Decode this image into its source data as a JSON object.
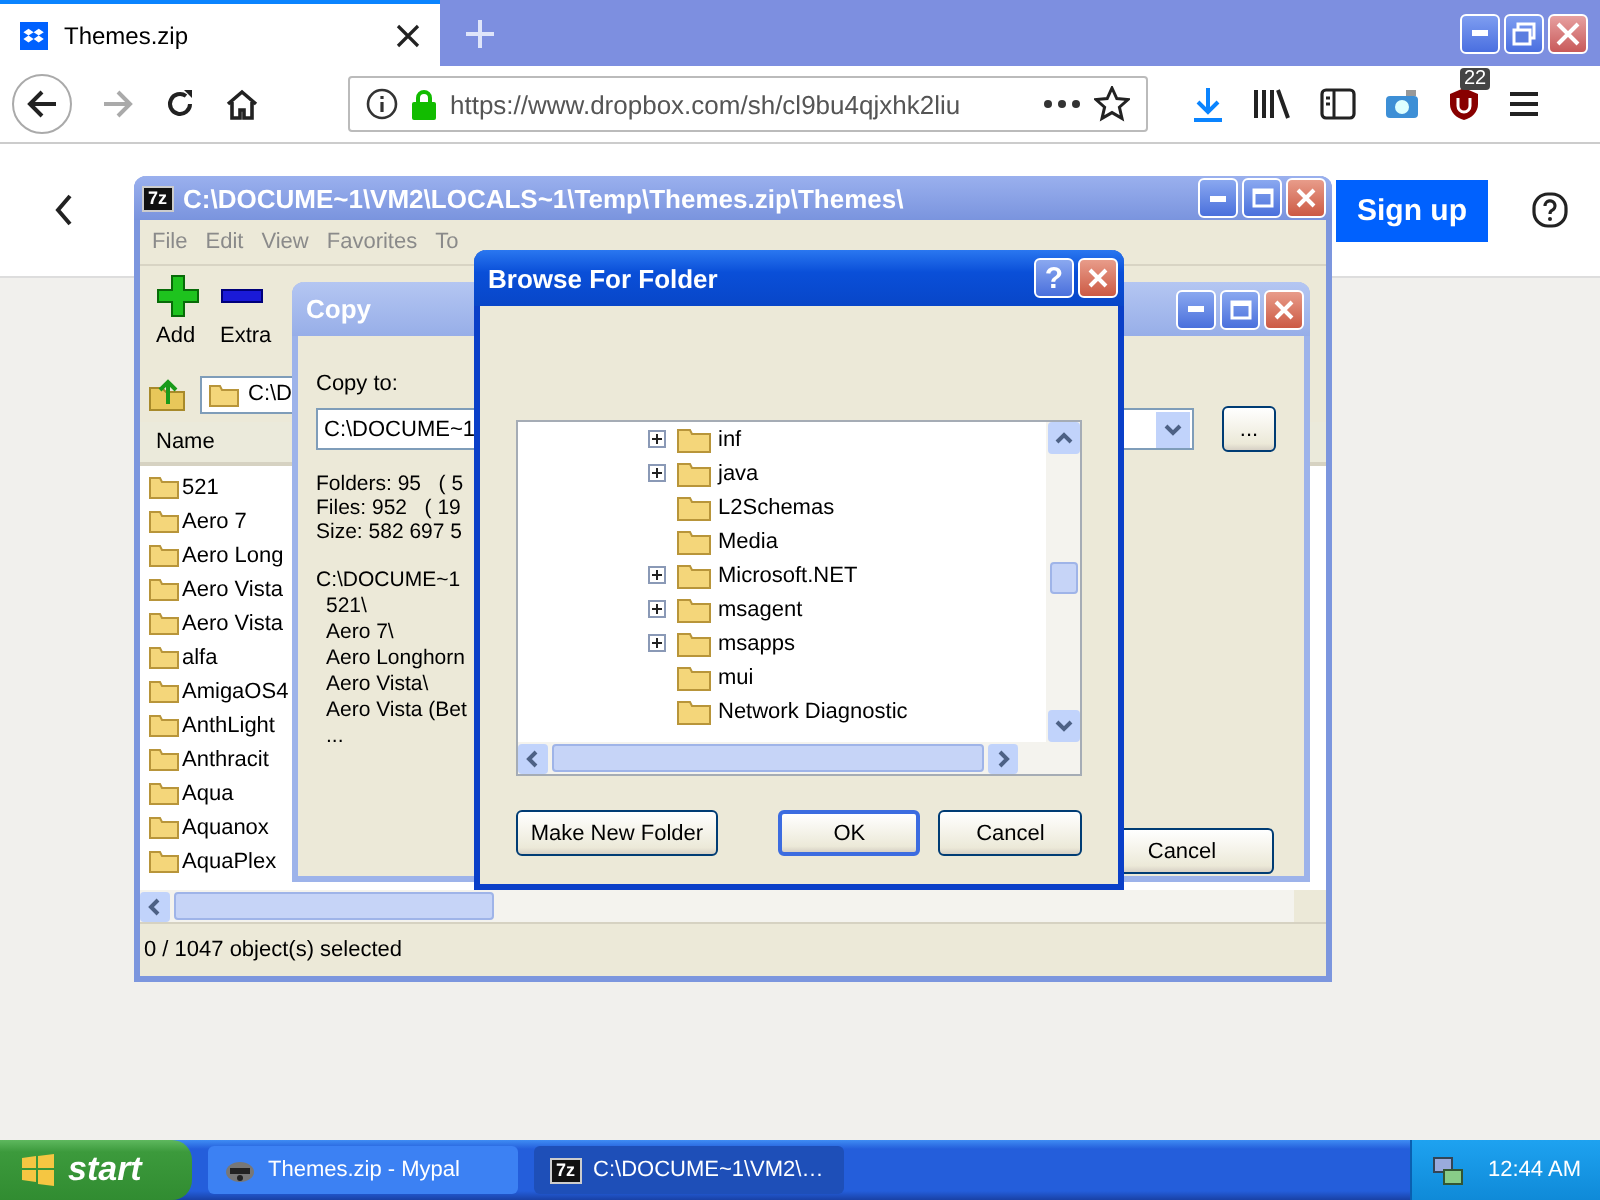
{
  "browser": {
    "tab_title": "Themes.zip",
    "forward_disabled": true,
    "url": "https://www.dropbox.com/sh/cl9bu4qjxhk2liu",
    "badge": "22"
  },
  "page": {
    "signup": "Sign up"
  },
  "zip_window": {
    "icon_label": "7z",
    "title": "C:\\DOCUME~1\\VM2\\LOCALS~1\\Temp\\Themes.zip\\Themes\\",
    "menu": [
      "File",
      "Edit",
      "View",
      "Favorites",
      "To"
    ],
    "toolbar": [
      {
        "label": "Add",
        "kind": "add"
      },
      {
        "label": "Extra",
        "kind": "extract"
      }
    ],
    "address": "C:\\D",
    "column": "Name",
    "files": [
      "521",
      "Aero 7",
      "Aero Long",
      "Aero Vista",
      "Aero Vista",
      "alfa",
      "AmigaOS4",
      "AnthLight",
      "Anthracit",
      "Aqua",
      "Aquanox",
      "AquaPlex"
    ],
    "status": "0 / 1047 object(s) selected"
  },
  "copy_dialog": {
    "title": "Copy",
    "label": "Copy to:",
    "path": "C:\\DOCUME~1",
    "stats": [
      "Folders: 95   ( 5",
      "Files: 952   ( 19",
      "Size: 582 697 5"
    ],
    "items": [
      "C:\\DOCUME~1",
      "521\\",
      "Aero 7\\",
      "Aero Longhorn",
      "Aero Vista\\",
      "Aero Vista (Bet",
      "..."
    ],
    "browse_button": "...",
    "cancel_button": "Cancel"
  },
  "browse_dialog": {
    "title": "Browse For Folder",
    "help": "?",
    "tree": [
      {
        "name": "inf",
        "expandable": true
      },
      {
        "name": "java",
        "expandable": true
      },
      {
        "name": "L2Schemas",
        "expandable": false
      },
      {
        "name": "Media",
        "expandable": false
      },
      {
        "name": "Microsoft.NET",
        "expandable": true
      },
      {
        "name": "msagent",
        "expandable": true
      },
      {
        "name": "msapps",
        "expandable": true
      },
      {
        "name": "mui",
        "expandable": false
      },
      {
        "name": "Network Diagnostic",
        "expandable": false
      }
    ],
    "buttons": [
      {
        "label": "Make New Folder",
        "kind": "new"
      },
      {
        "label": "OK",
        "kind": "ok"
      },
      {
        "label": "Cancel",
        "kind": "cancel"
      }
    ]
  },
  "taskbar": {
    "start": "start",
    "tasks": [
      {
        "label": "Themes.zip - Mypal",
        "kind": "browser",
        "selected": false
      },
      {
        "label": "C:\\DOCUME~1\\VM2\\…",
        "kind": "archive",
        "icon_label": "7z",
        "selected": true
      }
    ],
    "clock": "12:44 AM"
  }
}
